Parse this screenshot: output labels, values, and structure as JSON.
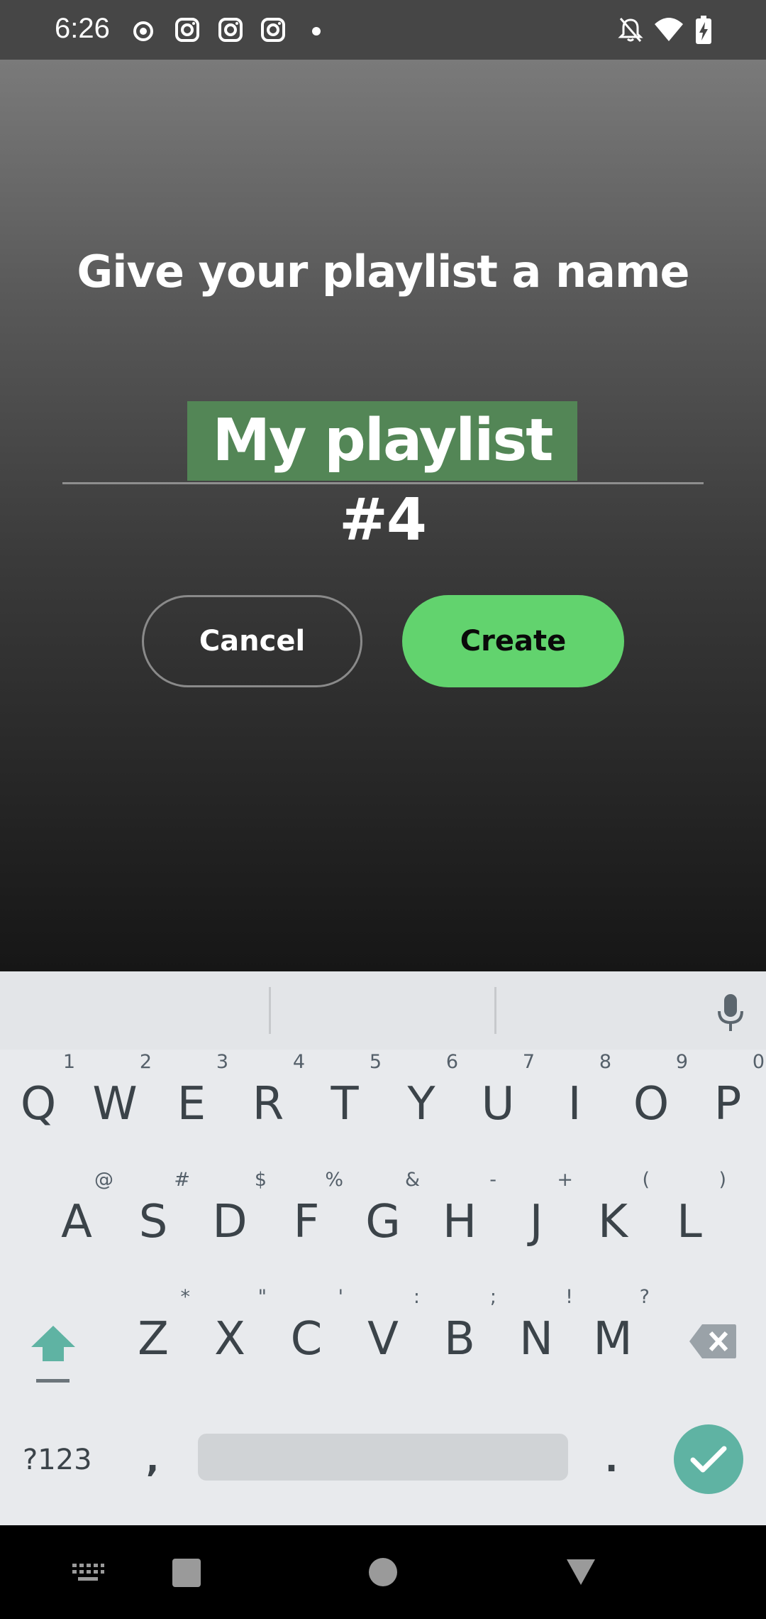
{
  "status_bar": {
    "time": "6:26",
    "left_icons": [
      "record-dot-icon",
      "instagram-icon",
      "instagram-icon",
      "instagram-icon",
      "notification-dot-icon"
    ],
    "right_icons": [
      "notifications-off-icon",
      "wifi-icon",
      "battery-charging-icon"
    ]
  },
  "dialog": {
    "title": "Give your playlist a name",
    "input_value": "My playlist #4",
    "cancel_label": "Cancel",
    "create_label": "Create"
  },
  "colors": {
    "accent_green": "#62d36e",
    "selection": "#538656",
    "keyboard_accent": "#5fb3a3"
  },
  "keyboard": {
    "row1": [
      {
        "key": "Q",
        "hint": "1"
      },
      {
        "key": "W",
        "hint": "2"
      },
      {
        "key": "E",
        "hint": "3"
      },
      {
        "key": "R",
        "hint": "4"
      },
      {
        "key": "T",
        "hint": "5"
      },
      {
        "key": "Y",
        "hint": "6"
      },
      {
        "key": "U",
        "hint": "7"
      },
      {
        "key": "I",
        "hint": "8"
      },
      {
        "key": "O",
        "hint": "9"
      },
      {
        "key": "P",
        "hint": "0"
      }
    ],
    "row2": [
      {
        "key": "A",
        "hint": "@"
      },
      {
        "key": "S",
        "hint": "#"
      },
      {
        "key": "D",
        "hint": "$"
      },
      {
        "key": "F",
        "hint": "%"
      },
      {
        "key": "G",
        "hint": "&"
      },
      {
        "key": "H",
        "hint": "-"
      },
      {
        "key": "J",
        "hint": "+"
      },
      {
        "key": "K",
        "hint": "("
      },
      {
        "key": "L",
        "hint": ")"
      }
    ],
    "row3": [
      {
        "key": "Z",
        "hint": "*"
      },
      {
        "key": "X",
        "hint": "\""
      },
      {
        "key": "C",
        "hint": "'"
      },
      {
        "key": "V",
        "hint": ":"
      },
      {
        "key": "B",
        "hint": ";"
      },
      {
        "key": "N",
        "hint": "!"
      },
      {
        "key": "M",
        "hint": "?"
      }
    ],
    "symbols_label": "?123",
    "comma": ",",
    "period": "."
  },
  "nav_bar": {
    "buttons": [
      "keyboard-switch-icon",
      "recents-icon",
      "home-icon",
      "back-icon"
    ]
  }
}
